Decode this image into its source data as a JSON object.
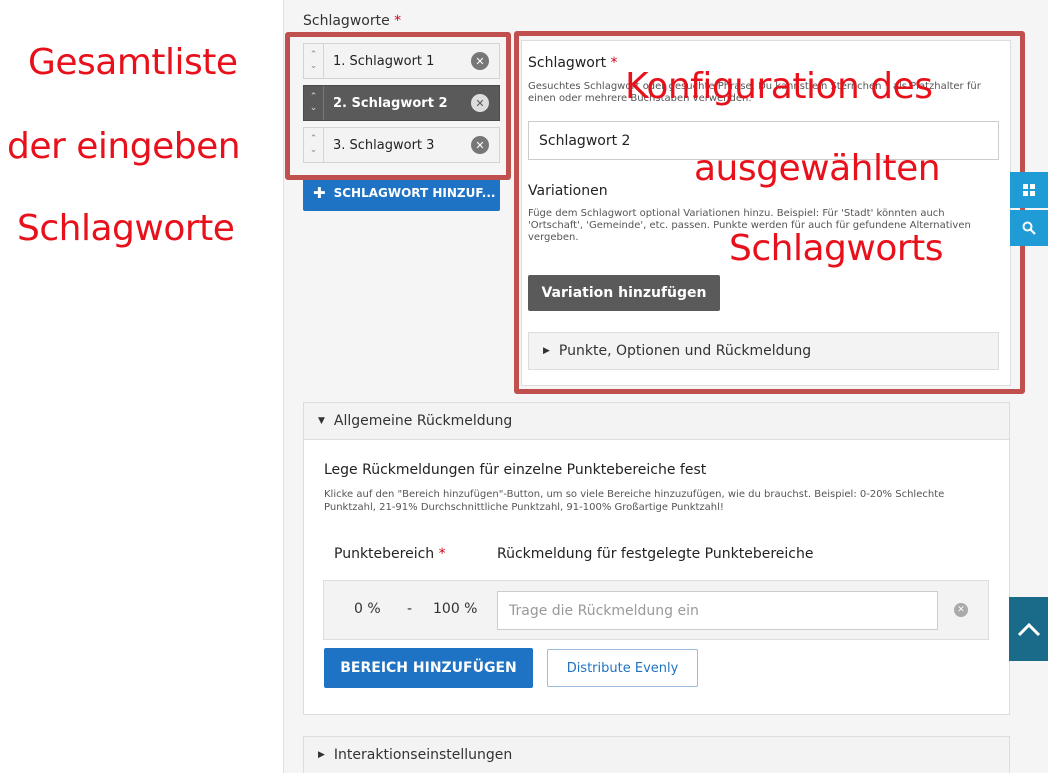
{
  "annotations": {
    "left_line1": "Gesamtliste",
    "left_line2": "der eingeben",
    "left_line3": "Schlagworte",
    "right_line1": "Konfiguration des",
    "right_line2": "ausgewählten",
    "right_line3": "Schlagworts",
    "color": "#e8111b"
  },
  "keywords": {
    "label": "Schlagworte",
    "required_mark": "*",
    "items": [
      {
        "label": "1. Schlagwort 1"
      },
      {
        "label": "2. Schlagwort 2",
        "selected": true
      },
      {
        "label": "3. Schlagwort 3"
      }
    ],
    "add_button": "SCHLAGWORT HINZUF..."
  },
  "config": {
    "keyword_label": "Schlagwort",
    "required_mark": "*",
    "keyword_help": "Gesuchtes Schlagwort oder gesuchte Phrase. Du kannst ein Sternchen * als Platzhalter für einen oder mehrere Buchstaben verwenden.",
    "keyword_value": "Schlagwort 2",
    "variations_label": "Variationen",
    "variations_help": "Füge dem Schlagwort optional Variationen hinzu. Beispiel: Für 'Stadt' könnten auch 'Ortschaft', 'Gemeinde', etc. passen. Punkte werden für auch für gefundene Alternativen vergeben.",
    "add_variation": "Variation hinzufügen",
    "points_section": "Punkte, Optionen und Rückmeldung"
  },
  "feedback": {
    "section_title": "Allgemeine Rückmeldung",
    "title": "Lege Rückmeldungen für einzelne Punktebereiche fest",
    "help": "Klicke auf den \"Bereich hinzufügen\"-Button, um so viele Bereiche hinzuzufügen, wie du brauchst. Beispiel: 0-20% Schlechte Punktzahl, 21-91% Durchschnittliche Punktzahl, 91-100% Großartige Punktzahl!",
    "col_range": "Punktebereich",
    "required_mark": "*",
    "col_feedback": "Rückmeldung für festgelegte Punktebereiche",
    "range_from": "0 %",
    "range_sep": "-",
    "range_to": "100 %",
    "input_placeholder": "Trage die Rückmeldung ein",
    "add_range": "BEREICH HINZUFÜGEN",
    "distribute": "Distribute Evenly"
  },
  "interaction": {
    "section_title": "Interaktionseinstellungen"
  },
  "colors": {
    "accent": "#1f73c4",
    "annotation_box": "#c0504d",
    "selected_item": "#5a5a5a"
  }
}
